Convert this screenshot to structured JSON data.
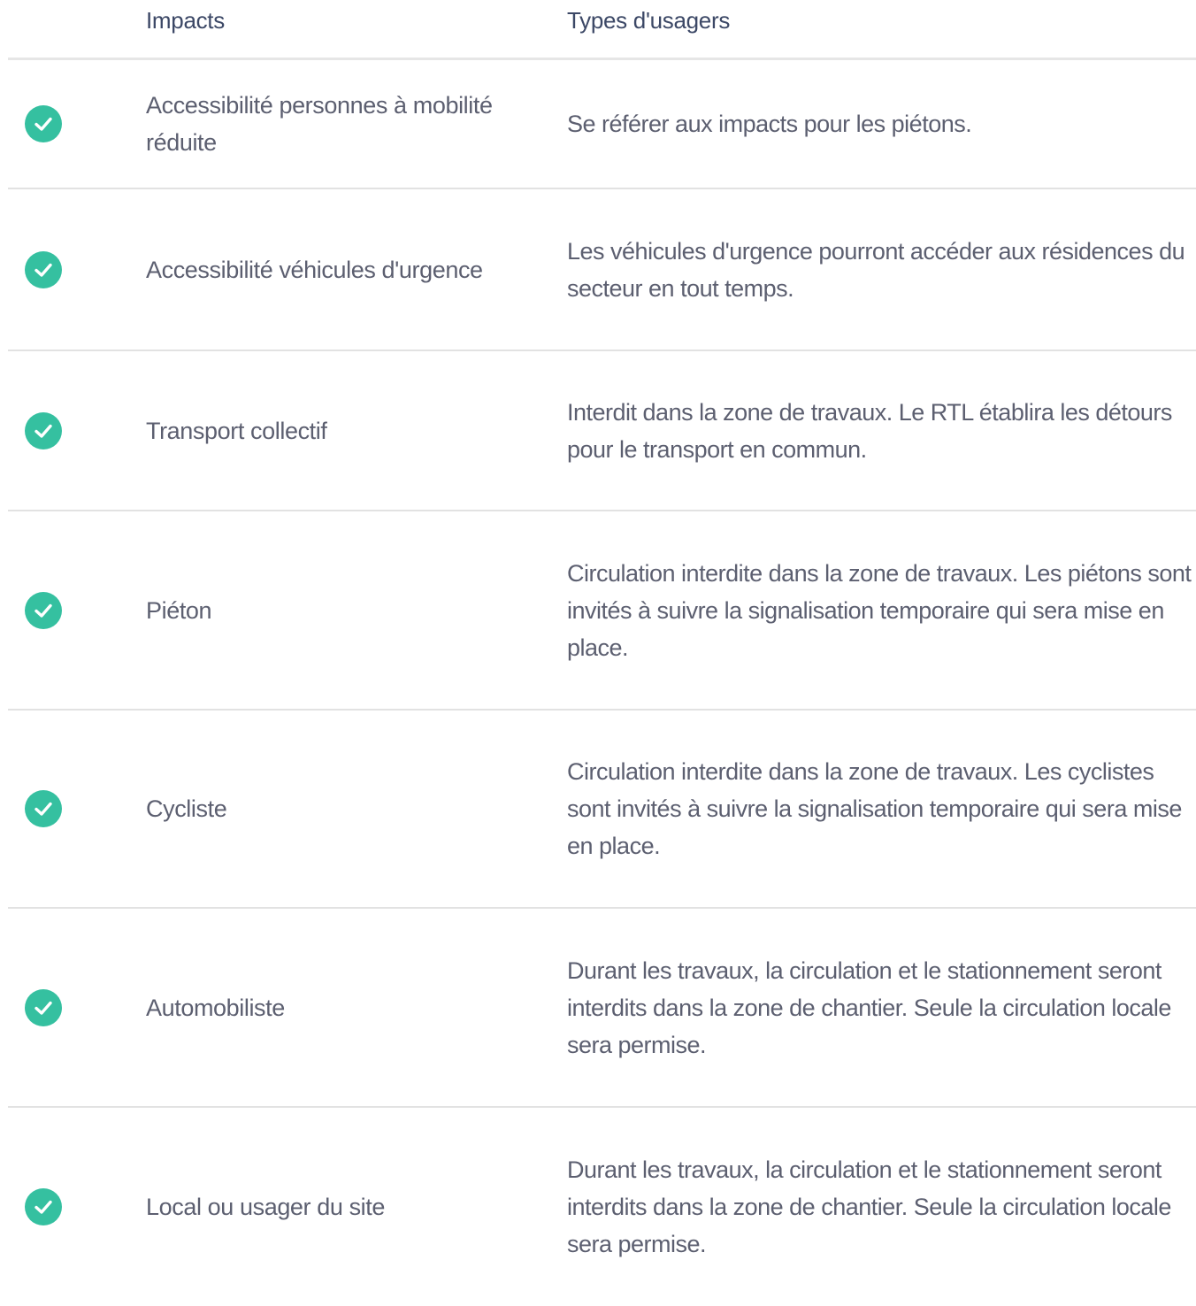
{
  "header": {
    "impacts": "Impacts",
    "types": "Types d'usagers"
  },
  "colors": {
    "check": "#35c0a0",
    "header_text": "#3c4866",
    "body_text": "#5c5f70",
    "divider": "#e2e2e2"
  },
  "rows": [
    {
      "icon": "check-circle-icon",
      "impact": "Accessibilité personnes à mobilité réduite",
      "description": "Se référer aux impacts pour les piétons."
    },
    {
      "icon": "check-circle-icon",
      "impact": "Accessibilité véhicules d'urgence",
      "description": "Les véhicules d'urgence pourront accéder aux résidences du secteur en tout temps."
    },
    {
      "icon": "check-circle-icon",
      "impact": "Transport collectif",
      "description": "Interdit dans la zone de travaux. Le RTL établira les détours pour le transport en commun."
    },
    {
      "icon": "check-circle-icon",
      "impact": "Piéton",
      "description": "Circulation interdite dans la zone de travaux. Les piétons sont invités à suivre la signalisation temporaire qui sera mise en place."
    },
    {
      "icon": "check-circle-icon",
      "impact": "Cycliste",
      "description": "Circulation interdite dans la zone de travaux. Les cyclistes sont invités à suivre la signalisation temporaire qui sera mise en place."
    },
    {
      "icon": "check-circle-icon",
      "impact": "Automobiliste",
      "description": "Durant les travaux, la circulation et le stationnement seront interdits dans la zone de chantier. Seule la circulation locale sera permise."
    },
    {
      "icon": "check-circle-icon",
      "impact": "Local ou usager du site",
      "description": "Durant les travaux, la circulation et le stationnement seront interdits dans la zone de chantier. Seule la circulation locale sera permise."
    }
  ]
}
